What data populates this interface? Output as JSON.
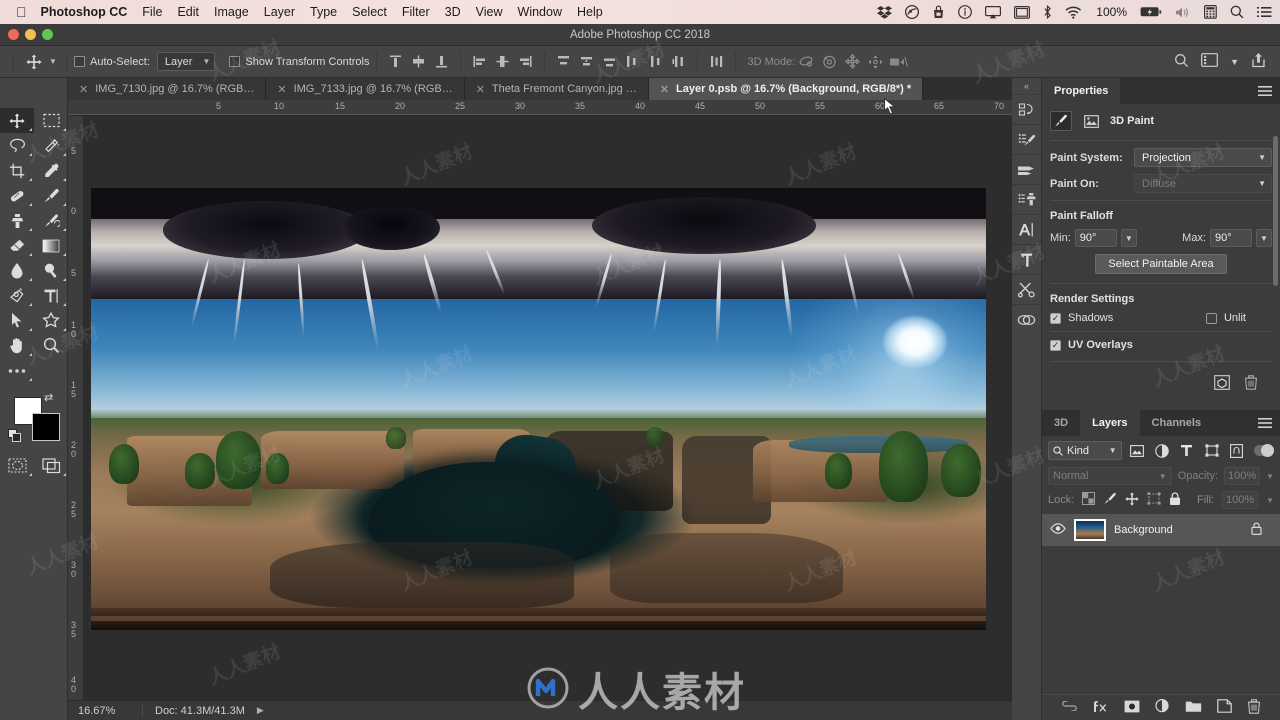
{
  "macbar": {
    "apple_glyph": "",
    "app_name": "Photoshop CC",
    "menus": [
      "File",
      "Edit",
      "Image",
      "Layer",
      "Type",
      "Select",
      "Filter",
      "3D",
      "View",
      "Window",
      "Help"
    ],
    "battery_pct": "100%",
    "status_icons": [
      "dropbox-icon",
      "creative-cloud-icon",
      "bag-icon",
      "info-circle-icon",
      "airplay-icon",
      "display-icon",
      "bluetooth-icon",
      "wifi-icon",
      "battery-icon",
      "volume-icon",
      "calculator-icon",
      "spotlight-search-icon",
      "notification-center-icon"
    ]
  },
  "titlebar": {
    "title": "Adobe Photoshop CC 2018"
  },
  "options": {
    "tool": "move-tool",
    "auto_select_label": "Auto-Select:",
    "auto_select_value": "Layer",
    "show_transform_label": "Show Transform Controls",
    "align_icons": [
      "align-top-edges",
      "align-vertical-centers",
      "align-bottom-edges",
      "align-left-edges",
      "align-horizontal-centers",
      "align-right-edges"
    ],
    "distribute_icons": [
      "distribute-top-edges",
      "distribute-vertical-centers",
      "distribute-bottom-edges",
      "distribute-left-edges",
      "distribute-horizontal-centers",
      "distribute-right-edges",
      "distribute-spacing"
    ],
    "mode_3d_label": "3D Mode:",
    "mode_3d_icons": [
      "rotate-3d-object",
      "roll-3d-object",
      "pan-3d-object",
      "slide-3d-object",
      "scale-3d-object"
    ],
    "right_icons": [
      "search-icon",
      "workspace-switcher-icon",
      "chevron-down-icon",
      "share-icon"
    ]
  },
  "tabs": [
    {
      "label": "IMG_7130.jpg @ 16.7% (RGB…",
      "active": false
    },
    {
      "label": "IMG_7133.jpg @ 16.7% (RGB…",
      "active": false
    },
    {
      "label": "Theta Fremont Canyon.jpg …",
      "active": false
    },
    {
      "label": "Layer 0.psb @ 16.7% (Background, RGB/8*) *",
      "active": true
    }
  ],
  "toolbar": {
    "tools": [
      "move-tool",
      "rectangular-marquee-tool",
      "lasso-tool",
      "magic-wand-tool",
      "crop-tool",
      "eyedropper-tool",
      "spot-healing-brush-tool",
      "brush-tool",
      "clone-stamp-tool",
      "history-brush-tool",
      "eraser-tool",
      "gradient-tool",
      "blur-tool",
      "dodge-tool",
      "pen-tool",
      "horizontal-type-tool",
      "path-selection-tool",
      "custom-shape-tool",
      "hand-tool",
      "zoom-tool",
      "edit-toolbar-tool"
    ],
    "selected_tool": "move-tool",
    "foreground_color": "#ffffff",
    "background_color": "#000000",
    "quick_mask_icon": "quick-mask-mode-icon",
    "screen_mode_icon": "screen-mode-icon"
  },
  "minidock": {
    "collapse_label": "«",
    "icons": [
      "history-panel-icon",
      "brush-panel-icon",
      "brush-settings-panel-icon",
      "clone-source-panel-icon",
      "character-panel-icon",
      "paragraph-panel-icon",
      "tool-presets-panel-icon",
      "styles-panel-icon"
    ]
  },
  "ruler": {
    "h_labels": [
      "5",
      "10",
      "15",
      "20",
      "25",
      "30",
      "35",
      "40",
      "45",
      "50",
      "55",
      "60",
      "65",
      "70"
    ],
    "v_labels": [
      "5",
      "0",
      "5",
      "1 0",
      "1 5",
      "2 0",
      "2 5",
      "3 0",
      "3 5",
      "4 0"
    ]
  },
  "properties": {
    "tab_label": "Properties",
    "menu_icon": "panel-menu-icon",
    "header_title": "3D Paint",
    "header_icons": [
      "paint-brush-icon",
      "texture-image-icon"
    ],
    "paint_system_label": "Paint System:",
    "paint_system_value": "Projection",
    "paint_on_label": "Paint On:",
    "paint_on_value": "Diffuse",
    "paint_falloff_label": "Paint Falloff",
    "min_label": "Min:",
    "min_value": "90°",
    "max_label": "Max:",
    "max_value": "90°",
    "select_paintable_label": "Select Paintable Area",
    "render_settings_label": "Render Settings",
    "shadows_label": "Shadows",
    "shadows_checked": true,
    "unlit_label": "Unlit",
    "unlit_checked": false,
    "uv_overlays_label": "UV Overlays",
    "uv_overlays_checked": true,
    "footer_icons": [
      "new-3d-layer-icon",
      "delete-icon"
    ]
  },
  "layers": {
    "tabs": [
      {
        "label": "3D",
        "active": false
      },
      {
        "label": "Layers",
        "active": true
      },
      {
        "label": "Channels",
        "active": false
      }
    ],
    "menu_icon": "panel-menu-icon",
    "filter_label": "Kind",
    "filter_icons": [
      "filter-pixel-icon",
      "filter-adjustment-icon",
      "filter-type-icon",
      "filter-shape-icon",
      "filter-smart-object-icon"
    ],
    "blend_mode": "Normal",
    "opacity_label": "Opacity:",
    "opacity_value": "100%",
    "lock_label": "Lock:",
    "lock_icons": [
      "lock-transparent-pixels-icon",
      "lock-image-pixels-icon",
      "lock-position-icon",
      "lock-artboard-icon",
      "lock-all-icon"
    ],
    "fill_label": "Fill:",
    "fill_value": "100%",
    "rows": [
      {
        "name": "Background",
        "visible": true,
        "locked": true
      }
    ],
    "footer_icons": [
      "link-layers-icon",
      "layer-style-fx-icon",
      "add-layer-mask-icon",
      "new-adjustment-layer-icon",
      "new-group-icon",
      "new-layer-icon",
      "delete-layer-icon"
    ]
  },
  "statusbar": {
    "zoom": "16.67%",
    "doc": "Doc: 41.3M/41.3M",
    "arrow_icon": "chevron-right-icon"
  },
  "watermark": {
    "text": "人人素材",
    "logo_icon": "rr-logo-icon"
  },
  "colors": {
    "panel_bg": "#3c3c3c",
    "toolbar_bg": "#454545",
    "canvas_bg": "#2d2d2d",
    "accent_selected": "#565656",
    "menubar_tint": "#f0dcd8"
  }
}
